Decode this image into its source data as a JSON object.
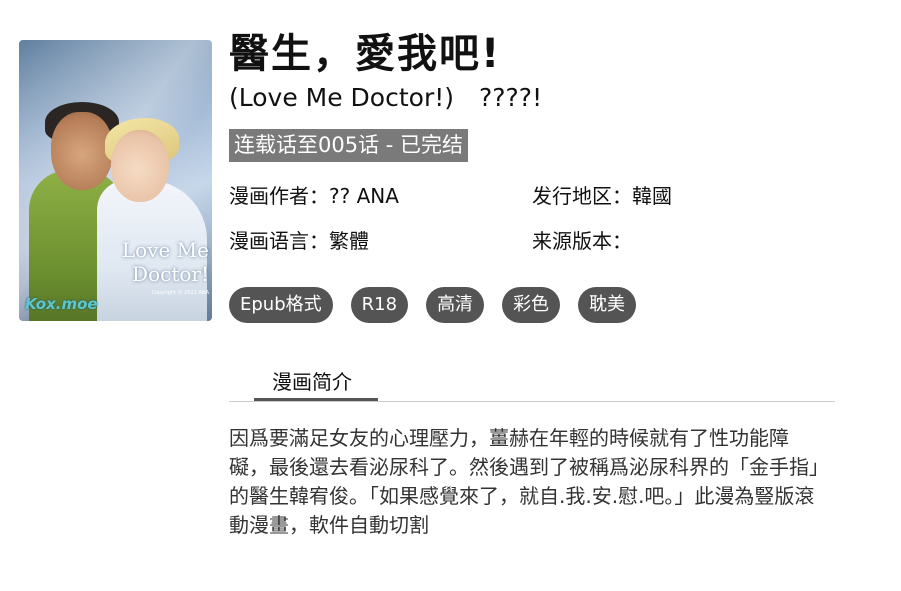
{
  "cover": {
    "title_text": "Love Me Doctor!",
    "credit_text": "Copyright © 2021 ANA",
    "logo_text": "Kox.moe"
  },
  "comic": {
    "title": "醫生，愛我吧!",
    "subtitle": "(Love Me Doctor!)　????!",
    "status": "连载话至005话 - 已完结",
    "author": "漫画作者：?? ANA",
    "region": "发行地区：韓國",
    "language": "漫画语言：繁體",
    "source": "来源版本："
  },
  "tags": [
    "Epub格式",
    "R18",
    "高清",
    "彩色",
    "耽美"
  ],
  "synopsis": {
    "tab_label": "漫画简介",
    "text": "因爲要滿足女友的心理壓力，薑赫在年輕的時候就有了性功能障礙，最後還去看泌尿科了。然後遇到了被稱爲泌尿科界的「金手指」的醫生韓宥俊。「如果感覺來了，就自.我.安.慰.吧。」此漫為豎版滾動漫畫，軟件自動切割"
  }
}
